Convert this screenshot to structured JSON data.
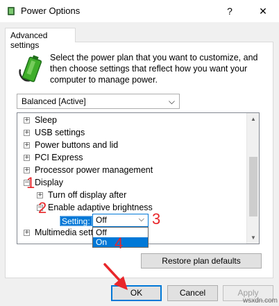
{
  "window": {
    "title": "Power Options",
    "help_glyph": "?",
    "close_glyph": "✕"
  },
  "tab": {
    "label": "Advanced settings"
  },
  "description": "Select the power plan that you want to customize, and then choose settings that reflect how you want your computer to manage power.",
  "plan_select": {
    "value": "Balanced [Active]",
    "chevron": "⌵"
  },
  "tree": {
    "items": [
      {
        "label": "Sleep",
        "toggle": "+"
      },
      {
        "label": "USB settings",
        "toggle": "+"
      },
      {
        "label": "Power buttons and lid",
        "toggle": "+"
      },
      {
        "label": "PCI Express",
        "toggle": "+"
      },
      {
        "label": "Processor power management",
        "toggle": "+"
      },
      {
        "label": "Display",
        "toggle": "−"
      },
      {
        "label": "Turn off display after",
        "toggle": "+"
      },
      {
        "label": "Enable adaptive brightness",
        "toggle": "−"
      },
      {
        "label": "Multimedia setti",
        "toggle": "+"
      }
    ],
    "setting_label": "Setting:",
    "setting_value": "Off",
    "setting_chevron": "⌵",
    "options": [
      "Off",
      "On"
    ],
    "scroll_up": "▲",
    "scroll_down": "▼"
  },
  "buttons": {
    "restore": "Restore plan defaults",
    "ok": "OK",
    "cancel": "Cancel",
    "apply": "Apply"
  },
  "markers": [
    "1",
    "2",
    "3",
    "4"
  ],
  "watermark": "wsxdn.com",
  "colors": {
    "selection": "#0078d7",
    "annotation": "#e8262a",
    "battery": "#3fae2a"
  }
}
